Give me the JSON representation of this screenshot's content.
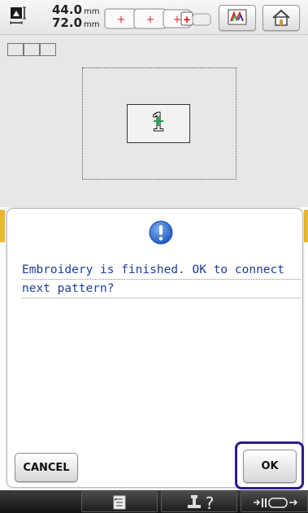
{
  "toolbar": {
    "size_icon": "pattern-size-icon",
    "width_value": "44.0",
    "width_unit": "mm",
    "height_value": "72.0",
    "height_unit": "mm",
    "hoop_icon": "hoop-size-selector-icon",
    "color_icon": "thread-color-icon",
    "home_icon": "home-icon"
  },
  "preview": {
    "grid_icon": "grid-display-icon",
    "pattern_glyph": "1"
  },
  "dialog": {
    "icon": "info-exclamation-icon",
    "message_lines": [
      "Embroidery is finished. OK to connect",
      "next pattern?"
    ],
    "cancel_label": "CANCEL",
    "ok_label": "OK",
    "highlight_color": "#2f1a8e"
  },
  "bottombar": {
    "buttons": [
      {
        "icon": "checklist-icon"
      },
      {
        "icon": "help-machine-icon"
      },
      {
        "icon": "thread-tension-icon"
      }
    ]
  },
  "colors": {
    "message_text": "#1e3f9a",
    "accent_yellow": "#e8b830",
    "icon_blue": "#2e6fd0"
  }
}
